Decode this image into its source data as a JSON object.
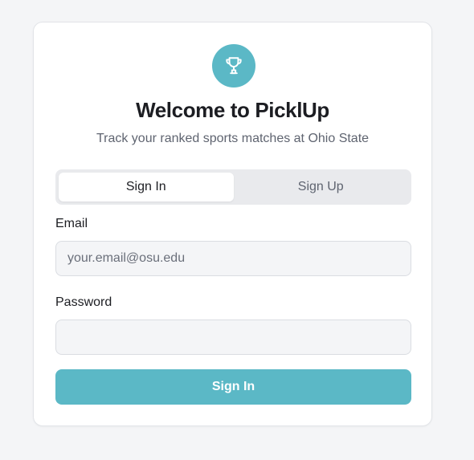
{
  "app": {
    "title": "Welcome to PicklUp",
    "subtitle": "Track your ranked sports matches at Ohio State",
    "logo_icon": "trophy-icon",
    "accent_color": "#5bb8c6"
  },
  "tabs": [
    {
      "label": "Sign In",
      "active": true
    },
    {
      "label": "Sign Up",
      "active": false
    }
  ],
  "form": {
    "email_label": "Email",
    "email_placeholder": "your.email@osu.edu",
    "email_value": "",
    "password_label": "Password",
    "password_placeholder": "",
    "password_value": "",
    "submit_label": "Sign In"
  }
}
